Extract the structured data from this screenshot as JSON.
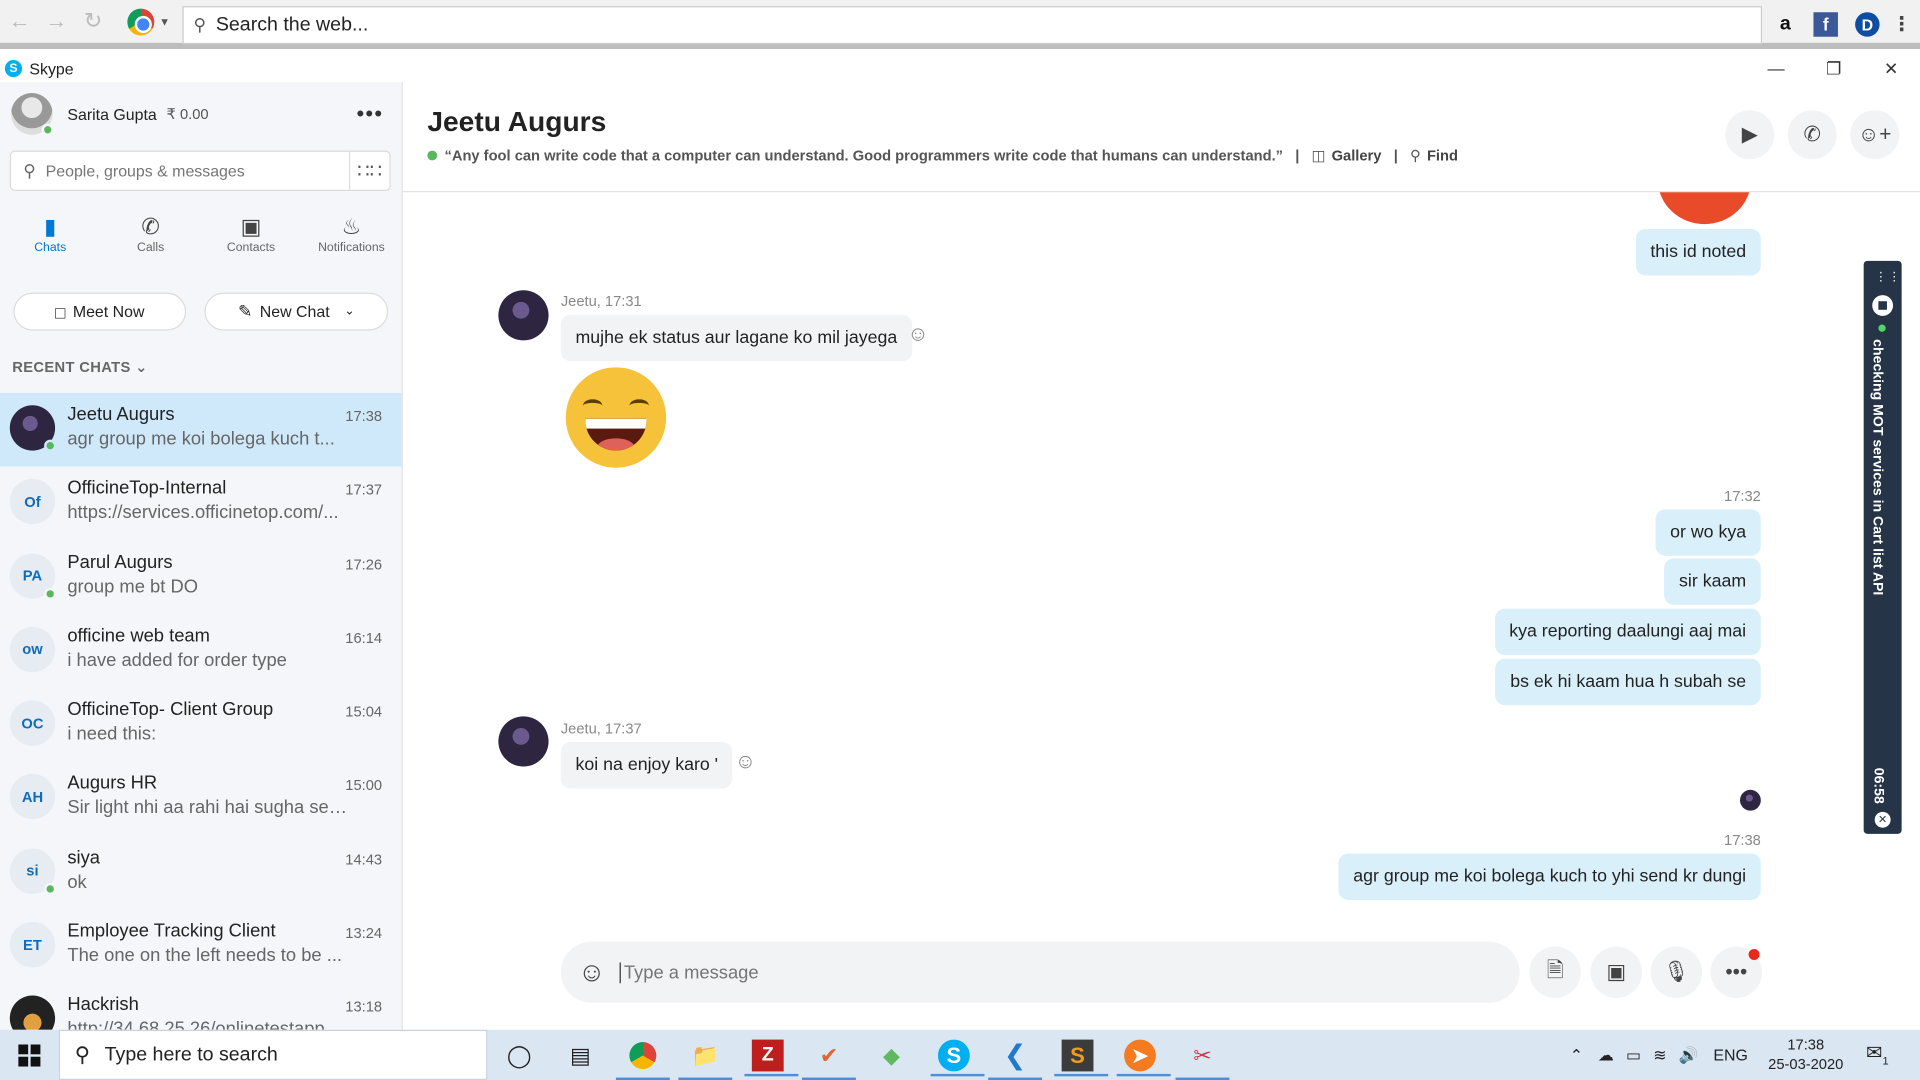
{
  "browser": {
    "search_placeholder": "Search the web...",
    "extensions": [
      "amazon-icon",
      "facebook-icon",
      "dashlane-icon",
      "menu-icon"
    ]
  },
  "window": {
    "title": "Skype"
  },
  "profile": {
    "name": "Sarita Gupta",
    "credit": "₹ 0.00"
  },
  "sidebar": {
    "search_placeholder": "People, groups & messages",
    "tabs": [
      {
        "label": "Chats",
        "icon": "chat-icon"
      },
      {
        "label": "Calls",
        "icon": "phone-icon"
      },
      {
        "label": "Contacts",
        "icon": "contacts-icon"
      },
      {
        "label": "Notifications",
        "icon": "bell-icon"
      }
    ],
    "meet_now": "Meet Now",
    "new_chat": "New Chat",
    "recent_label": "RECENT CHATS",
    "chats": [
      {
        "initials": "",
        "name": "Jeetu Augurs",
        "preview": "agr group me koi bolega kuch t...",
        "time": "17:38",
        "active": true,
        "online": true
      },
      {
        "initials": "Of",
        "name": "OfficineTop-Internal",
        "preview": "https://services.officinetop.com/...",
        "time": "17:37"
      },
      {
        "initials": "PA",
        "name": "Parul Augurs",
        "preview": "group me bt DO",
        "time": "17:26",
        "online": true
      },
      {
        "initials": "ow",
        "name": "officine web team",
        "preview": "i have added for order type",
        "time": "16:14"
      },
      {
        "initials": "OC",
        "name": "OfficineTop- Client Group",
        "preview": "i need this:",
        "time": "15:04"
      },
      {
        "initials": "AH",
        "name": "Augurs HR",
        "preview": "Sir light nhi aa rahi hai sugha se ...",
        "time": "15:00"
      },
      {
        "initials": "si",
        "name": "siya",
        "preview": "ok",
        "time": "14:43",
        "online": true
      },
      {
        "initials": "ET",
        "name": "Employee Tracking Client",
        "preview": "The one on the left needs to be ...",
        "time": "13:24"
      },
      {
        "initials": "",
        "name": "Hackrish",
        "preview": "http://34.68.25.26/onlinetestapp...",
        "time": "13:18"
      }
    ]
  },
  "conversation": {
    "title": "Jeetu Augurs",
    "mood": "“Any fool can write code that a computer can understand. Good programmers write code that humans can understand.”",
    "gallery": "Gallery",
    "find": "Find",
    "messages": {
      "out_1": "this id noted",
      "in_1_meta": "Jeetu, 17:31",
      "in_1": "mujhe ek status aur lagane ko mil jayega",
      "out_time_2": "17:32",
      "out_2a": "or wo kya",
      "out_2b": "sir kaam",
      "out_2c": "kya reporting daalungi aaj mai",
      "out_2d": "bs ek hi kaam hua h subah se",
      "in_2_meta": "Jeetu, 17:37",
      "in_2": "koi na enjoy karo '",
      "out_time_3": "17:38",
      "out_3": "agr group me koi bolega kuch to yhi send kr dungi"
    },
    "compose_placeholder": "Type a message"
  },
  "tracker": {
    "task": "checking MOT services in Cart list API",
    "time": "06:58"
  },
  "taskbar": {
    "search_placeholder": "Type here to search",
    "language": "ENG",
    "time": "17:38",
    "date": "25-03-2020",
    "notification_count": "1"
  }
}
